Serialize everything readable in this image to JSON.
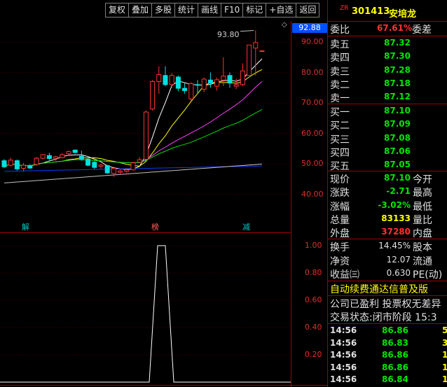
{
  "toolbar": {
    "items": [
      "复权",
      "叠加",
      "多股",
      "统计",
      "画线",
      "F10",
      "标记",
      "+自选",
      "返回"
    ]
  },
  "stock": {
    "prefix": "ZR",
    "code": "301413",
    "name": "安培龙"
  },
  "weibi": {
    "label": "委比",
    "value": "67.61%",
    "label2": "委差"
  },
  "asks": [
    {
      "label": "卖五",
      "price": "87.32"
    },
    {
      "label": "卖四",
      "price": "87.30"
    },
    {
      "label": "卖三",
      "price": "87.28"
    },
    {
      "label": "卖二",
      "price": "87.18"
    },
    {
      "label": "卖一",
      "price": "87.12"
    }
  ],
  "bids": [
    {
      "label": "买一",
      "price": "87.10"
    },
    {
      "label": "买二",
      "price": "87.09"
    },
    {
      "label": "买三",
      "price": "87.08"
    },
    {
      "label": "买四",
      "price": "87.06"
    },
    {
      "label": "买五",
      "price": "87.05"
    }
  ],
  "quote": [
    {
      "l": "现价",
      "v": "87.10",
      "r": "今开",
      "vc": "#00e600"
    },
    {
      "l": "涨跌",
      "v": "-2.71",
      "r": "最高",
      "vc": "#00e600"
    },
    {
      "l": "涨幅",
      "v": "-3.02%",
      "r": "最低",
      "vc": "#00e600"
    },
    {
      "l": "总量",
      "v": "83133",
      "r": "量比",
      "vc": "#ffff00"
    },
    {
      "l": "外盘",
      "v": "37280",
      "r": "内盘",
      "vc": "#ff3232"
    }
  ],
  "fundamentals": [
    {
      "l": "换手",
      "v": "14.45%",
      "r": "股本"
    },
    {
      "l": "净资",
      "v": "12.07",
      "r": "流通"
    },
    {
      "l": "收益㈢",
      "v": "0.630",
      "r": "PE(动)"
    }
  ],
  "news": {
    "ticker": "自动续费通达信普及版",
    "notice": "公司已盈利 投票权无差异",
    "status_label": "交易状态:",
    "status_value": "闭市阶段 15:3"
  },
  "ticks": [
    {
      "time": "14:56",
      "price": "86.86",
      "extra": "5"
    },
    {
      "time": "14:56",
      "price": "86.83",
      "extra": "3"
    },
    {
      "time": "14:56",
      "price": "86.86",
      "extra": "1"
    },
    {
      "time": "14:56",
      "price": "86.86",
      "extra": "1"
    },
    {
      "time": "14:56",
      "price": "86.84",
      "extra": "1"
    }
  ],
  "price_axis": {
    "current": "92.88",
    "labels": [
      "90.00",
      "80.00",
      "70.00",
      "60.00",
      "50.00",
      "40.00"
    ]
  },
  "indicator_axis": {
    "labels": [
      "1.00",
      "0.80",
      "0.60",
      "0.40",
      "0.20"
    ]
  },
  "chart_annotations": {
    "high": "93.80"
  },
  "signals": [
    "解",
    "榜",
    "减"
  ],
  "colors": {
    "up": "#ff3232",
    "down": "#00e0e0",
    "ma5": "#ffffff",
    "ma10": "#ffff00",
    "ma20": "#ff40ff",
    "ma30": "#00e000",
    "ma60": "#0040ff",
    "ma120": "#c0c0c0",
    "indicator": "#ffffff"
  },
  "candles": [
    [
      51.0,
      51.5,
      48.6,
      49.0
    ],
    [
      49.5,
      52.0,
      49.0,
      51.2
    ],
    [
      51.0,
      51.4,
      47.8,
      48.3
    ],
    [
      48.5,
      50.3,
      47.5,
      49.5
    ],
    [
      49.4,
      49.9,
      48.3,
      48.6
    ],
    [
      49.8,
      52.2,
      49.3,
      51.8
    ],
    [
      51.8,
      53.2,
      51.5,
      53.0
    ],
    [
      52.7,
      53.6,
      51.3,
      51.7
    ],
    [
      51.8,
      52.6,
      51.0,
      52.3
    ],
    [
      52.0,
      53.5,
      51.8,
      53.0
    ],
    [
      53.3,
      54.3,
      53.0,
      54.0
    ],
    [
      54.5,
      54.7,
      53.4,
      53.7
    ],
    [
      52.5,
      54.3,
      51.0,
      51.6
    ],
    [
      51.5,
      51.9,
      49.2,
      49.5
    ],
    [
      50.5,
      51.0,
      48.3,
      48.8
    ],
    [
      49.2,
      50.0,
      48.4,
      49.6
    ],
    [
      49.4,
      49.7,
      46.7,
      47.0
    ],
    [
      46.8,
      49.0,
      45.7,
      48.5
    ],
    [
      47.2,
      48.2,
      46.6,
      47.6
    ],
    [
      47.5,
      48.5,
      47.0,
      48.0
    ],
    [
      48.0,
      50.6,
      47.8,
      50.3
    ],
    [
      50.5,
      52.2,
      50.2,
      51.3
    ],
    [
      51.5,
      67.5,
      51.2,
      67.0
    ],
    [
      68.0,
      77.5,
      67.5,
      77.0
    ],
    [
      77.0,
      82.0,
      73.0,
      79.3
    ],
    [
      79.0,
      82.0,
      75.5,
      76.0
    ],
    [
      76.0,
      79.8,
      75.0,
      79.0
    ],
    [
      78.5,
      79.0,
      73.8,
      74.8
    ],
    [
      74.8,
      76.5,
      73.0,
      74.0
    ],
    [
      71.3,
      76.8,
      70.7,
      76.3
    ],
    [
      76.0,
      77.5,
      73.0,
      75.8
    ],
    [
      74.5,
      78.3,
      73.5,
      77.8
    ],
    [
      77.5,
      80.0,
      75.0,
      76.5
    ],
    [
      75.5,
      78.3,
      74.0,
      77.6
    ],
    [
      77.5,
      85.0,
      75.5,
      78.8
    ],
    [
      79.0,
      80.0,
      75.0,
      76.5
    ],
    [
      75.5,
      78.0,
      74.5,
      76.0
    ],
    [
      76.0,
      83.0,
      75.5,
      80.5
    ],
    [
      79.0,
      89.0,
      79.0,
      89.0
    ],
    [
      88.0,
      93.8,
      79.0,
      89.8
    ],
    [
      87.0,
      87.2,
      86.8,
      87.1
    ]
  ]
}
